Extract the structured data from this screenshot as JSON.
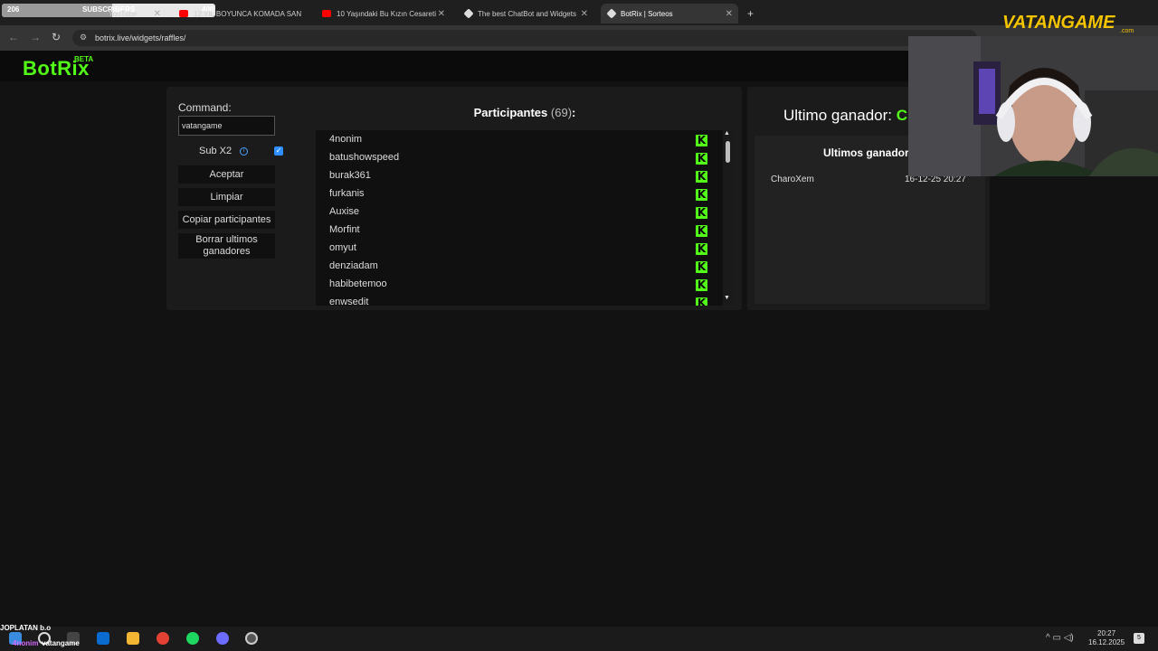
{
  "overlay": {
    "subs_current": "206",
    "subs_label": "SUBSCRIBERS",
    "subs_goal": "400",
    "subs_progress": 0.515
  },
  "browser": {
    "tabs": [
      {
        "label": "YouTube"
      },
      {
        "label": "12 YIL BOYUNCA KOMADA SAN"
      },
      {
        "label": "10 Yaşındaki Bu Kızın Cesareti"
      },
      {
        "label": "The best ChatBot and Widgets"
      },
      {
        "label": "BotRix | Sorteos"
      }
    ],
    "new_tab": "+",
    "url": "botrix.live/widgets/raffles/"
  },
  "app": {
    "logo": "BotRix",
    "beta": "BETA",
    "command_label": "Command:",
    "command_value": "vatangame",
    "sub_x2_label": "Sub X2",
    "sub_x2_checked": true,
    "buttons": {
      "accept": "Aceptar",
      "clear": "Limpiar",
      "copy": "Copiar participantes",
      "delete_winners": "Borrar ultimos ganadores"
    },
    "participants_title": "Participantes",
    "participants_count": "(69)",
    "participants_colon": ":",
    "participants": [
      "4nonim",
      "batushowspeed",
      "burak361",
      "furkanis",
      "Auxise",
      "Morfint",
      "omyut",
      "denziadam",
      "habibetemoo",
      "enwsedit"
    ],
    "last_winner_label": "Ultimo ganador:",
    "last_winner_name": "Cha",
    "winners_title": "Ultimos ganadores",
    "winners": [
      {
        "name": "CharoXem",
        "date": "16-12-25 20:27"
      }
    ]
  },
  "stream": {
    "brand": "VATANGAME",
    "brand_suffix": ".com"
  },
  "taskbar": {
    "user1": "JOPLATAN",
    "user1_suffix": "b.o",
    "user2": "4nonim",
    "user3": "vatangame",
    "time": "20:27",
    "date": "16.12.2025",
    "notifications": "5"
  },
  "colors": {
    "accent": "#53fc18",
    "background": "#121212",
    "panel": "#1b1b1b"
  }
}
